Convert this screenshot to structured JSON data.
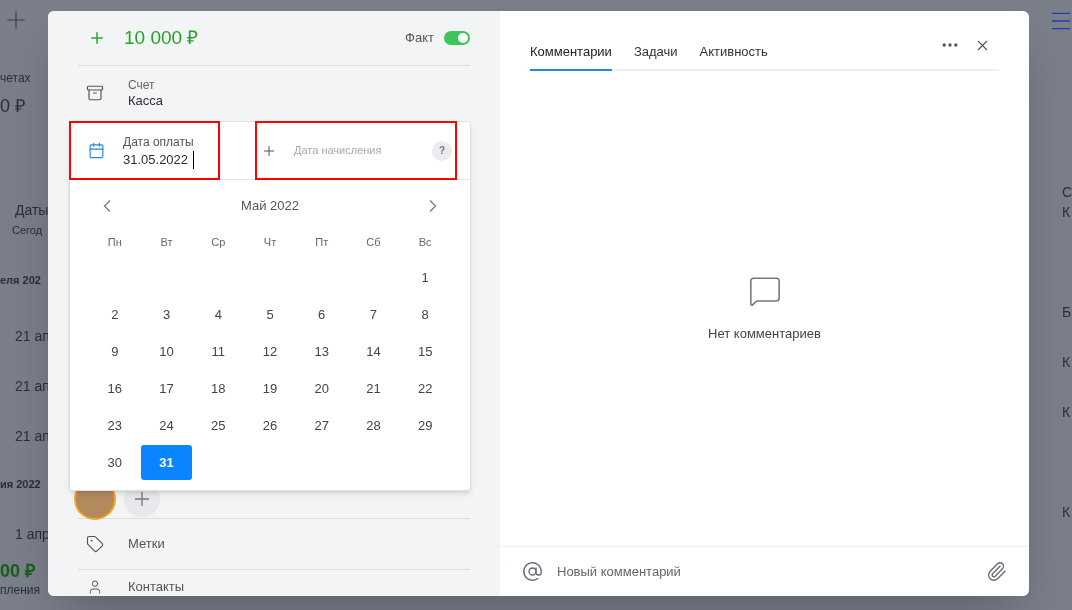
{
  "background": {
    "left_column": [
      "четах",
      "0 ₽",
      "Даты",
      "Сегод",
      "еля 202",
      "21 ап",
      "21 ап",
      "21 ап",
      "ия 2022",
      "1 апр",
      "00 ₽",
      "пления"
    ],
    "right_column": [
      "С",
      "К",
      "Б",
      "К",
      "К",
      "К"
    ]
  },
  "operation": {
    "amount": "10 000 ₽",
    "fact": {
      "label": "Факт",
      "on": true
    },
    "account": {
      "label": "Счет",
      "value": "Касса"
    },
    "payment_date": {
      "label": "Дата оплаты",
      "value": "31.05.2022"
    },
    "accrual_date": {
      "placeholder": "Дата начисления",
      "help": "?"
    },
    "calendar": {
      "month": "Май 2022",
      "weekdays": [
        "Пн",
        "Вт",
        "Ср",
        "Чт",
        "Пт",
        "Сб",
        "Вс"
      ],
      "weeks": [
        [
          {
            "day": "1",
            "selected": false
          }
        ],
        [
          {
            "day": "2",
            "selected": false
          },
          {
            "day": "3",
            "selected": false
          },
          {
            "day": "4",
            "selected": false
          },
          {
            "day": "5",
            "selected": false
          },
          {
            "day": "6",
            "selected": false
          },
          {
            "day": "7",
            "selected": false
          },
          {
            "day": "8",
            "selected": false
          }
        ],
        [
          {
            "day": "9",
            "selected": false
          },
          {
            "day": "10",
            "selected": false
          },
          {
            "day": "11",
            "selected": false
          },
          {
            "day": "12",
            "selected": false
          },
          {
            "day": "13",
            "selected": false
          },
          {
            "day": "14",
            "selected": false
          },
          {
            "day": "15",
            "selected": false
          }
        ],
        [
          {
            "day": "16",
            "selected": false
          },
          {
            "day": "17",
            "selected": false
          },
          {
            "day": "18",
            "selected": false
          },
          {
            "day": "19",
            "selected": false
          },
          {
            "day": "20",
            "selected": false
          },
          {
            "day": "21",
            "selected": false
          },
          {
            "day": "22",
            "selected": false
          }
        ],
        [
          {
            "day": "23",
            "selected": false
          },
          {
            "day": "24",
            "selected": false
          },
          {
            "day": "25",
            "selected": false
          },
          {
            "day": "26",
            "selected": false
          },
          {
            "day": "27",
            "selected": false
          },
          {
            "day": "28",
            "selected": false
          },
          {
            "day": "29",
            "selected": false
          }
        ],
        [
          {
            "day": "30",
            "selected": false
          },
          {
            "day": "31",
            "selected": true
          }
        ]
      ]
    },
    "tags": "Метки",
    "contacts": "Контакты"
  },
  "comments": {
    "tabs": [
      {
        "label": "Комментарии",
        "selected": true
      },
      {
        "label": "Задачи",
        "selected": false
      },
      {
        "label": "Активность",
        "selected": false
      }
    ],
    "empty_text": "Нет комментариев",
    "input": {
      "placeholder": "Новый комментарий"
    }
  }
}
